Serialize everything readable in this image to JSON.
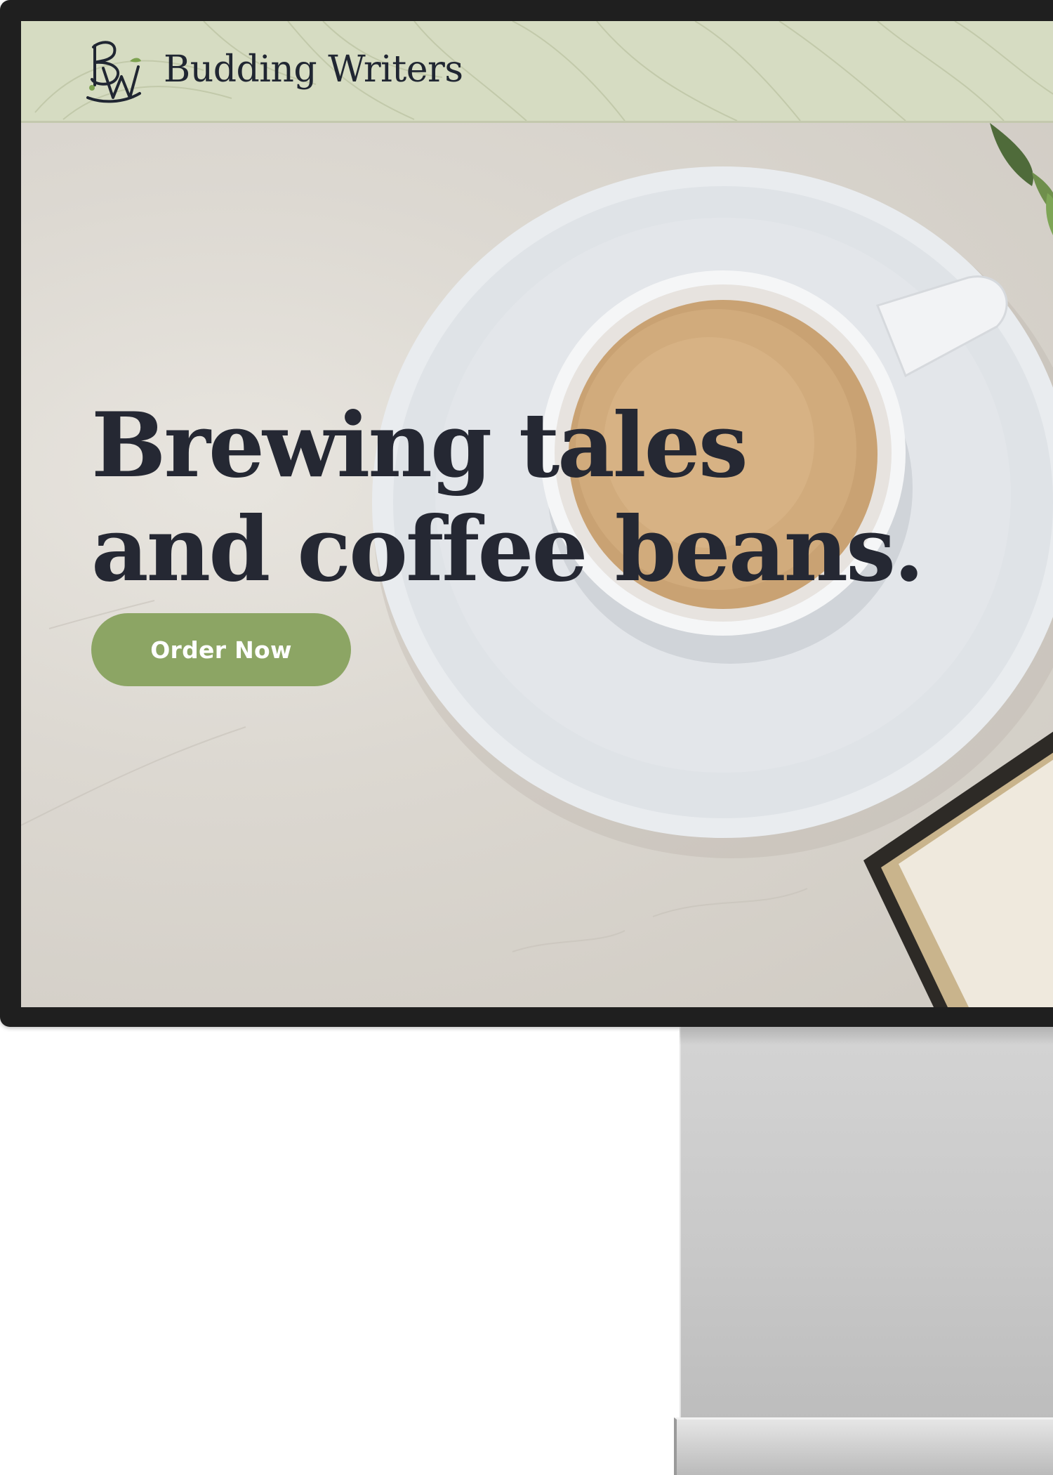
{
  "site": {
    "brand_name": "Budding Writers",
    "logo_monogram": "BW"
  },
  "hero": {
    "title_line1": "Brewing tales",
    "title_line2": "and coffee beans.",
    "cta_label": "Order Now"
  },
  "colors": {
    "header_bg": "#d6dcc2",
    "cta_bg": "#8ca564",
    "title_text": "#252833",
    "bezel": "#1f1f1f"
  },
  "icons": {
    "logo": "bw-monogram-icon",
    "leaves": "leaf-pattern-icon"
  }
}
